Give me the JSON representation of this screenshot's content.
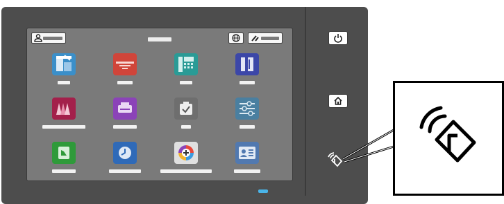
{
  "device": {
    "panel_color": "#4d4d4d",
    "screen_color": "#7a7a7a",
    "led_color": "#4ab4e8"
  },
  "status_bar": {
    "left_icon": "user-icon",
    "center_text": "",
    "right_icons": [
      "globe-icon",
      "wrench-icon"
    ]
  },
  "apps": [
    {
      "icon": "scan-icon",
      "color": "#3b8fc9"
    },
    {
      "icon": "print-icon",
      "color": "#d0453a"
    },
    {
      "icon": "fax-icon",
      "color": "#2a9b96"
    },
    {
      "icon": "copy-icon",
      "color": "#3c47a8"
    },
    {
      "icon": "workflow-icon",
      "color": "#a3204b"
    },
    {
      "icon": "print-from-icon",
      "color": "#8b43b8"
    },
    {
      "icon": "jobs-icon",
      "color": "#6e6e6e"
    },
    {
      "icon": "settings-sliders-icon",
      "color": "#4a7fa0"
    },
    {
      "icon": "id-card-copy-icon",
      "color": "#2f9a3a"
    },
    {
      "icon": "history-icon",
      "color": "#2f6ab8"
    },
    {
      "icon": "app-gallery-icon",
      "color": "#e0e0e0"
    },
    {
      "icon": "address-book-icon",
      "color": "#5179b0"
    }
  ],
  "hardware": {
    "power_button": "power-icon",
    "home_button": "home-icon",
    "nfc_reader": "nfc-icon"
  },
  "callout": {
    "icon": "nfc-icon"
  }
}
